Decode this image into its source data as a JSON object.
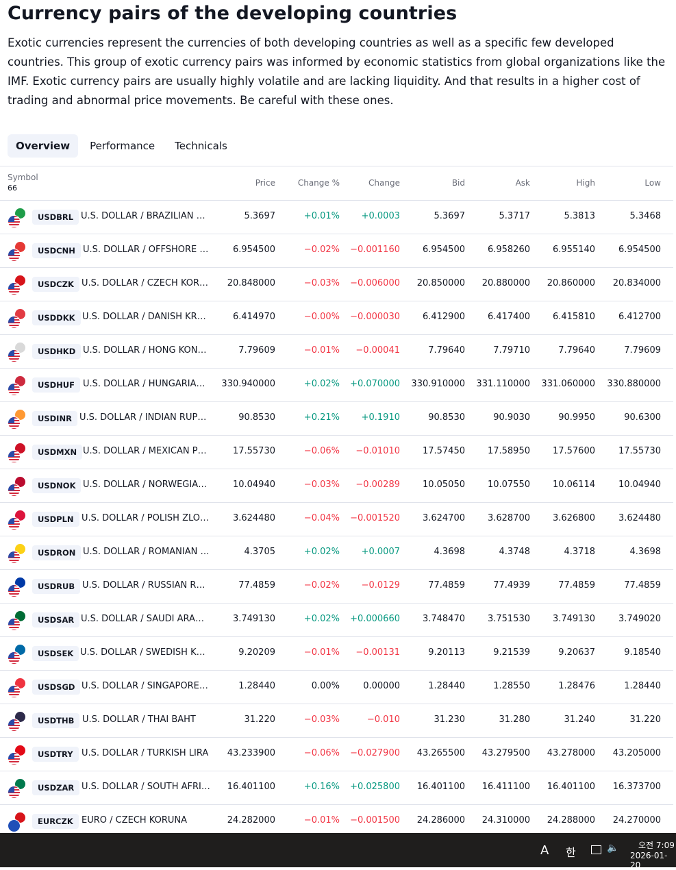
{
  "page": {
    "title": "Currency pairs of the developing countries",
    "description": "Exotic currencies represent the currencies of both developing countries as well as a specific few developed countries. This group of exotic currency pairs was informed by economic statistics from global organizations like the IMF. Exotic currency pairs are usually highly volatile and are lacking liquidity. And that results in a higher cost of trading and abnormal price movements. Be careful with these ones."
  },
  "tabs": [
    {
      "label": "Overview",
      "active": true
    },
    {
      "label": "Performance",
      "active": false
    },
    {
      "label": "Technicals",
      "active": false
    }
  ],
  "table": {
    "symbol_label": "Symbol",
    "symbol_count": "66",
    "columns": [
      "Price",
      "Change %",
      "Change",
      "Bid",
      "Ask",
      "High",
      "Low"
    ],
    "rows": [
      {
        "symbol": "USDBRL",
        "name": "U.S. DOLLAR / BRAZILIAN R...",
        "price": "5.3697",
        "change_pct": "+0.01%",
        "change": "+0.0003",
        "bid": "5.3697",
        "ask": "5.3717",
        "high": "5.3813",
        "low": "5.3468",
        "trend": "up",
        "flag_color": "#1f9d49"
      },
      {
        "symbol": "USDCNH",
        "name": "U.S. DOLLAR / OFFSHORE C...",
        "price": "6.954500",
        "change_pct": "−0.02%",
        "change": "−0.001160",
        "bid": "6.954500",
        "ask": "6.958260",
        "high": "6.955140",
        "low": "6.954500",
        "trend": "down",
        "flag_color": "#e53935"
      },
      {
        "symbol": "USDCZK",
        "name": "U.S. DOLLAR / CZECH KORU...",
        "price": "20.848000",
        "change_pct": "−0.03%",
        "change": "−0.006000",
        "bid": "20.850000",
        "ask": "20.880000",
        "high": "20.860000",
        "low": "20.834000",
        "trend": "down",
        "flag_color": "#d7141a"
      },
      {
        "symbol": "USDDKK",
        "name": "U.S. DOLLAR / DANISH KRONE",
        "price": "6.414970",
        "change_pct": "−0.00%",
        "change": "−0.000030",
        "bid": "6.412900",
        "ask": "6.417400",
        "high": "6.415810",
        "low": "6.412700",
        "trend": "down",
        "flag_color": "#e23b43"
      },
      {
        "symbol": "USDHKD",
        "name": "U.S. DOLLAR / HONG KONG ...",
        "price": "7.79609",
        "change_pct": "−0.01%",
        "change": "−0.00041",
        "bid": "7.79640",
        "ask": "7.79710",
        "high": "7.79640",
        "low": "7.79609",
        "trend": "down",
        "flag_color": "#d9d9d9"
      },
      {
        "symbol": "USDHUF",
        "name": "U.S. DOLLAR / HUNGARIAN ...",
        "price": "330.940000",
        "change_pct": "+0.02%",
        "change": "+0.070000",
        "bid": "330.910000",
        "ask": "331.110000",
        "high": "331.060000",
        "low": "330.880000",
        "trend": "up",
        "flag_color": "#cd2a3e"
      },
      {
        "symbol": "USDINR",
        "name": "U.S. DOLLAR / INDIAN RUPEE",
        "price": "90.8530",
        "change_pct": "+0.21%",
        "change": "+0.1910",
        "bid": "90.8530",
        "ask": "90.9030",
        "high": "90.9950",
        "low": "90.6300",
        "trend": "up",
        "flag_color": "#ff9933"
      },
      {
        "symbol": "USDMXN",
        "name": "U.S. DOLLAR / MEXICAN PESO",
        "price": "17.55730",
        "change_pct": "−0.06%",
        "change": "−0.01010",
        "bid": "17.57450",
        "ask": "17.58950",
        "high": "17.57600",
        "low": "17.55730",
        "trend": "down",
        "flag_color": "#ce1126"
      },
      {
        "symbol": "USDNOK",
        "name": "U.S. DOLLAR / NORWEGIAN ...",
        "price": "10.04940",
        "change_pct": "−0.03%",
        "change": "−0.00289",
        "bid": "10.05050",
        "ask": "10.07550",
        "high": "10.06114",
        "low": "10.04940",
        "trend": "down",
        "flag_color": "#ba0c2f"
      },
      {
        "symbol": "USDPLN",
        "name": "U.S. DOLLAR / POLISH ZLOTY",
        "price": "3.624480",
        "change_pct": "−0.04%",
        "change": "−0.001520",
        "bid": "3.624700",
        "ask": "3.628700",
        "high": "3.626800",
        "low": "3.624480",
        "trend": "down",
        "flag_color": "#dc143c"
      },
      {
        "symbol": "USDRON",
        "name": "U.S. DOLLAR / ROMANIAN L...",
        "price": "4.3705",
        "change_pct": "+0.02%",
        "change": "+0.0007",
        "bid": "4.3698",
        "ask": "4.3748",
        "high": "4.3718",
        "low": "4.3698",
        "trend": "up",
        "flag_color": "#fcd116"
      },
      {
        "symbol": "USDRUB",
        "name": "U.S. DOLLAR / RUSSIAN RUB...",
        "price": "77.4859",
        "change_pct": "−0.02%",
        "change": "−0.0129",
        "bid": "77.4859",
        "ask": "77.4939",
        "high": "77.4859",
        "low": "77.4859",
        "trend": "down",
        "flag_color": "#0039a6"
      },
      {
        "symbol": "USDSAR",
        "name": "U.S. DOLLAR / SAUDI ARABI...",
        "price": "3.749130",
        "change_pct": "+0.02%",
        "change": "+0.000660",
        "bid": "3.748470",
        "ask": "3.751530",
        "high": "3.749130",
        "low": "3.749020",
        "trend": "up",
        "flag_color": "#006c35"
      },
      {
        "symbol": "USDSEK",
        "name": "U.S. DOLLAR / SWEDISH KRO...",
        "price": "9.20209",
        "change_pct": "−0.01%",
        "change": "−0.00131",
        "bid": "9.20113",
        "ask": "9.21539",
        "high": "9.20637",
        "low": "9.18540",
        "trend": "down",
        "flag_color": "#006aa7"
      },
      {
        "symbol": "USDSGD",
        "name": "U.S. DOLLAR / SINGAPORE D...",
        "price": "1.28440",
        "change_pct": "0.00%",
        "change": "0.00000",
        "bid": "1.28440",
        "ask": "1.28550",
        "high": "1.28476",
        "low": "1.28440",
        "trend": "flat",
        "flag_color": "#ef3340"
      },
      {
        "symbol": "USDTHB",
        "name": "U.S. DOLLAR / THAI BAHT",
        "price": "31.220",
        "change_pct": "−0.03%",
        "change": "−0.010",
        "bid": "31.230",
        "ask": "31.280",
        "high": "31.240",
        "low": "31.220",
        "trend": "down",
        "flag_color": "#2d2a4a"
      },
      {
        "symbol": "USDTRY",
        "name": "U.S. DOLLAR / TURKISH LIRA",
        "price": "43.233900",
        "change_pct": "−0.06%",
        "change": "−0.027900",
        "bid": "43.265500",
        "ask": "43.279500",
        "high": "43.278000",
        "low": "43.205000",
        "trend": "down",
        "flag_color": "#e30a17"
      },
      {
        "symbol": "USDZAR",
        "name": "U.S. DOLLAR / SOUTH AFRIC...",
        "price": "16.401100",
        "change_pct": "+0.16%",
        "change": "+0.025800",
        "bid": "16.401100",
        "ask": "16.411100",
        "high": "16.401100",
        "low": "16.373700",
        "trend": "up",
        "flag_color": "#007a4d"
      },
      {
        "symbol": "EURCZK",
        "name": "EURO / CZECH KORUNA",
        "price": "24.282000",
        "change_pct": "−0.01%",
        "change": "−0.001500",
        "bid": "24.286000",
        "ask": "24.310000",
        "high": "24.288000",
        "low": "24.270000",
        "trend": "down",
        "flag_color": "#d7141a",
        "base": "eur"
      }
    ]
  },
  "taskbar": {
    "ime_mode": "A",
    "ime_lang": "한",
    "time": "오전 7:09",
    "date": "2026-01-20"
  },
  "colors": {
    "up": "#089981",
    "down": "#f23645",
    "usd_flag_blue": "#2a4ba8",
    "eur_flag_blue": "#1f4fb8"
  }
}
